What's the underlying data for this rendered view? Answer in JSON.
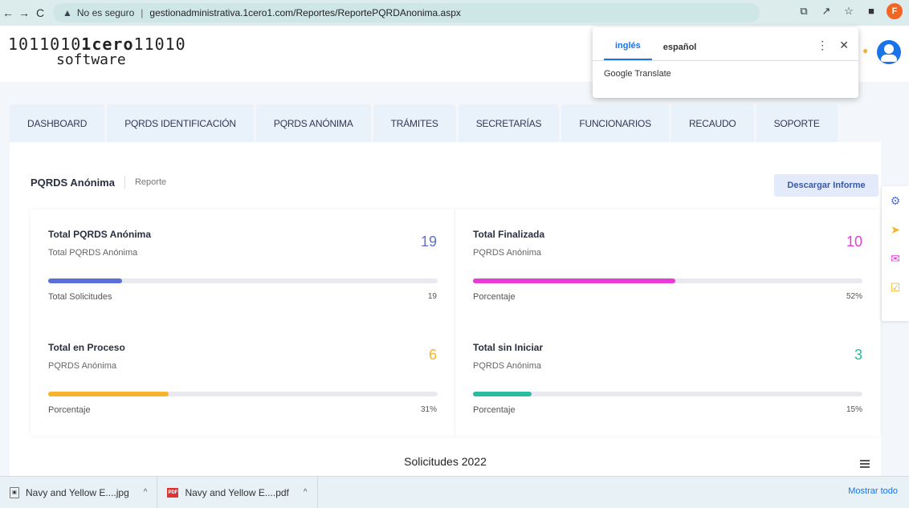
{
  "browser": {
    "security_label": "No es seguro",
    "url": "gestionadministrativa.1cero1.com/Reportes/ReportePQRDAnonima.aspx",
    "profile_initial": "F"
  },
  "logo": {
    "line1_a": "1011010",
    "line1_b": "1cero",
    "line1_c": "1",
    "line1_d": "1010",
    "line2": "software"
  },
  "translate": {
    "tabs": [
      "inglés",
      "español"
    ],
    "footer": "Google Translate"
  },
  "nav": {
    "tabs": [
      "DASHBOARD",
      "PQRDS IDENTIFICACIÓN",
      "PQRDS ANÓNIMA",
      "TRÁMITES",
      "SECRETARÍAS",
      "FUNCIONARIOS",
      "RECAUDO",
      "SOPORTE"
    ]
  },
  "report": {
    "title": "PQRDS Anónima",
    "subtitle": "Reporte",
    "download_label": "Descargar Informe"
  },
  "stats": [
    {
      "label": "Total PQRDS Anónima",
      "sub": "Total PQRDS Anónima",
      "value": "19",
      "color": "#5a6fd8",
      "progress": 0.19,
      "foot_label": "Total Solicitudes",
      "foot_value": "19"
    },
    {
      "label": "Total Finalizada",
      "sub": "PQRDS Anónima",
      "value": "10",
      "color": "#e83ad6",
      "progress": 0.52,
      "foot_label": "Porcentaje",
      "foot_value": "52%"
    },
    {
      "label": "Total en Proceso",
      "sub": "PQRDS Anónima",
      "value": "6",
      "color": "#f7b32b",
      "progress": 0.31,
      "foot_label": "Porcentaje",
      "foot_value": "31%"
    },
    {
      "label": "Total sin Iniciar",
      "sub": "PQRDS Anónima",
      "value": "3",
      "color": "#2bbba0",
      "progress": 0.15,
      "foot_label": "Porcentaje",
      "foot_value": "15%"
    }
  ],
  "chart": {
    "title": "Solicitudes 2022"
  },
  "downloads": {
    "items": [
      "Navy and Yellow E....jpg",
      "Navy and Yellow E....pdf"
    ],
    "show_all": "Mostrar todo"
  }
}
